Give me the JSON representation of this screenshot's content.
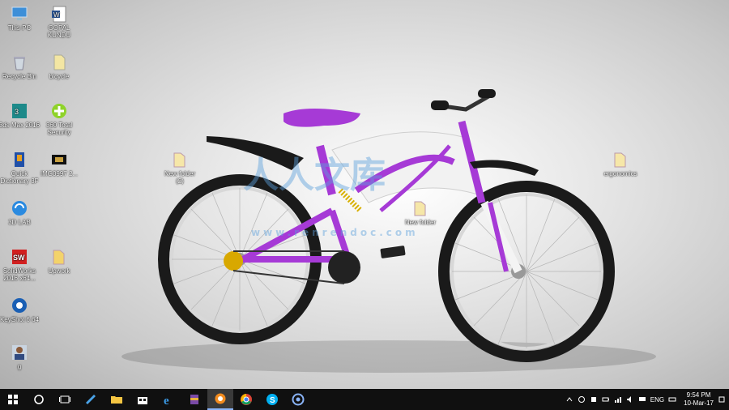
{
  "desktop_icons": [
    {
      "id": "this-pc",
      "label": "This PC",
      "icon": "computer-icon"
    },
    {
      "id": "gopal-kundu",
      "label": "GOPAL\nKUNDU",
      "icon": "word-document-icon"
    },
    {
      "id": "recycle-bin",
      "label": "Recycle Bin",
      "icon": "recycle-bin-icon"
    },
    {
      "id": "bicycle",
      "label": "bicycle",
      "icon": "file-icon"
    },
    {
      "id": "3ds-max",
      "label": "3ds Max 2016",
      "icon": "3ds-max-icon"
    },
    {
      "id": "total-security",
      "label": "360 Total\nSecurity",
      "icon": "security-shield-icon"
    },
    {
      "id": "quick-dictionary",
      "label": "Quick\nDictionary 3F",
      "icon": "dictionary-icon"
    },
    {
      "id": "img-file",
      "label": "IMG0997 2...",
      "icon": "image-file-icon"
    },
    {
      "id": "new-folder-2",
      "label": "New folder\n(2)",
      "icon": "folder-icon"
    },
    {
      "id": "ergonomics",
      "label": "ergonomics",
      "icon": "folder-icon"
    },
    {
      "id": "xilisoft",
      "label": "3D LAB",
      "icon": "refresh-app-icon"
    },
    {
      "id": "new-folder",
      "label": "New folder",
      "icon": "folder-icon"
    },
    {
      "id": "solidworks",
      "label": "SolidWorks\n2016 x64...",
      "icon": "solidworks-icon"
    },
    {
      "id": "upwork",
      "label": "Upwork",
      "icon": "folder-icon"
    },
    {
      "id": "keyshot",
      "label": "KeyShot 6 64",
      "icon": "keyshot-icon"
    },
    {
      "id": "photo",
      "label": "g",
      "icon": "person-photo-icon"
    }
  ],
  "watermark": {
    "cn_text": "人人文库",
    "url": "www.renrendoc.com"
  },
  "taskbar": {
    "items": [
      {
        "name": "start-button-icon"
      },
      {
        "name": "cortana-search-icon"
      },
      {
        "name": "task-view-icon"
      },
      {
        "name": "pen-app-icon"
      },
      {
        "name": "file-explorer-icon"
      },
      {
        "name": "store-icon"
      },
      {
        "name": "edge-browser-icon"
      },
      {
        "name": "winrar-icon"
      },
      {
        "name": "uc-browser-icon"
      },
      {
        "name": "chrome-icon"
      },
      {
        "name": "skype-icon"
      },
      {
        "name": "keyshot-taskbar-icon"
      }
    ],
    "tray": {
      "language": "ENG",
      "time": "9:54 PM",
      "date": "10-Mar-17"
    }
  },
  "colors": {
    "taskbar_bg": "#101010",
    "bike_purple": "#a63ad6",
    "active_underline": "#8ab4f8"
  }
}
